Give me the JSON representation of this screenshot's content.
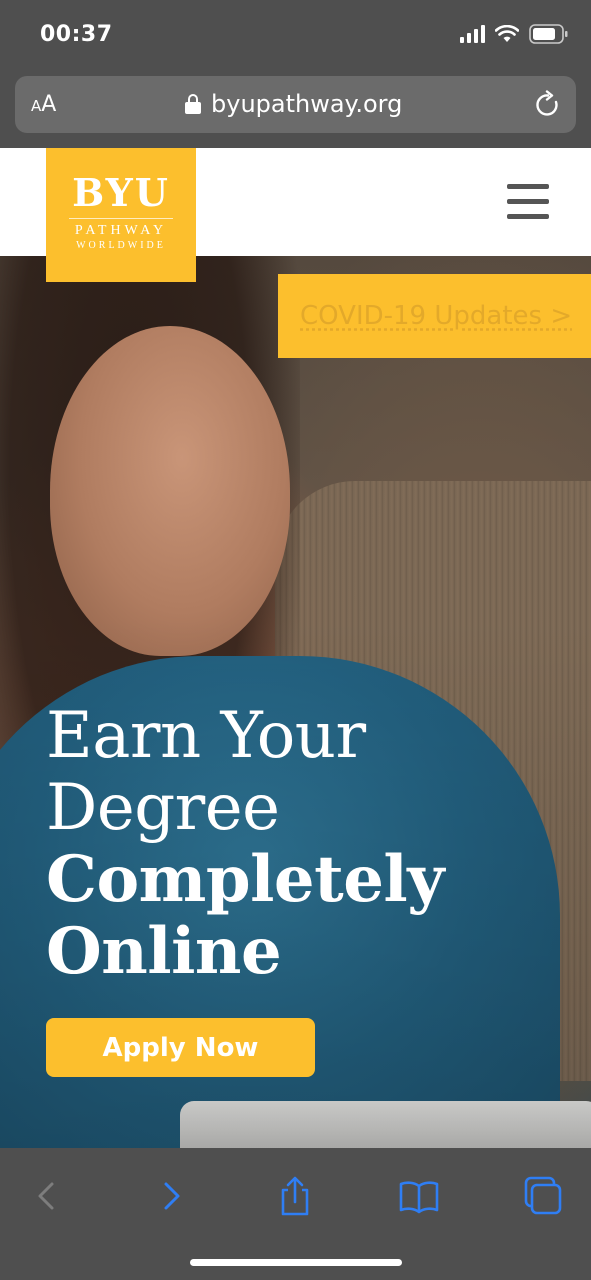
{
  "status_bar": {
    "time": "00:37"
  },
  "browser": {
    "text_size_small": "A",
    "text_size_big": "A",
    "url": "byupathway.org"
  },
  "site": {
    "logo": {
      "main": "BYU",
      "line2": "PATHWAY",
      "line3": "WORLDWIDE"
    },
    "covid_link": "COVID-19 Updates >",
    "headline": {
      "line1": "Earn Your",
      "line2": "Degree",
      "line3": "Completely",
      "line4": "Online"
    },
    "cta": "Apply Now"
  },
  "toolbar": {
    "items": [
      "back-icon",
      "forward-icon",
      "share-icon",
      "bookmarks-icon",
      "tabs-icon"
    ]
  },
  "colors": {
    "brand_yellow": "#fcbf2d",
    "chrome_gray": "#4f4f4f",
    "toolbar_blue": "#2f7ef4"
  }
}
